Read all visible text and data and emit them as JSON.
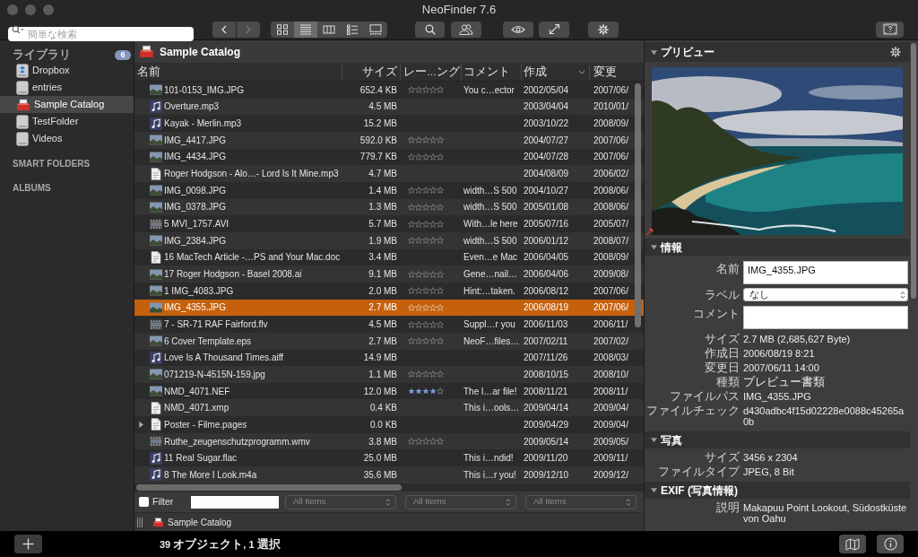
{
  "window": {
    "title": "NeoFinder 7.6"
  },
  "toolbar": {
    "search": {
      "placeholder": "簡単な検索"
    },
    "nav_buttons": [
      {
        "disabled": false
      },
      {
        "disabled": true
      }
    ],
    "view_buttons": [
      {
        "selected": false
      },
      {
        "selected": true
      },
      {
        "selected": false
      },
      {
        "selected": false
      },
      {
        "selected": false
      }
    ]
  },
  "sidebar": {
    "sections": [
      {
        "title": "ライブラリ",
        "badge": "6",
        "items": [
          {
            "kind": "cloud",
            "label": "Dropbox",
            "selected": false
          },
          {
            "kind": "volume",
            "label": "entries",
            "selected": false
          },
          {
            "kind": "catalog",
            "label": "Sample Catalog",
            "selected": true
          },
          {
            "kind": "volume",
            "label": "TestFolder",
            "selected": false
          },
          {
            "kind": "volume",
            "label": "Videos",
            "selected": false
          }
        ]
      },
      {
        "title": "SMART FOLDERS"
      },
      {
        "title": "ALBUMS"
      }
    ]
  },
  "table": {
    "title": "Sample Catalog",
    "columns": [
      {
        "label": "名前",
        "sorted": false
      },
      {
        "label": "サイズ",
        "sorted": false
      },
      {
        "label": "レー…ング",
        "sorted": false
      },
      {
        "label": "コメント",
        "sorted": false
      },
      {
        "label": "作成",
        "sorted": true
      },
      {
        "label": "変更",
        "sorted": false
      }
    ],
    "rows": [
      {
        "kind": "image",
        "name": "101-0153_IMG.JPG",
        "size": "652.4 KB",
        "stars": 0,
        "comment": "You c…ector",
        "created": "2002/05/04",
        "modified": "2007/06/",
        "selected": false
      },
      {
        "kind": "audio",
        "name": "Overture.mp3",
        "size": "4.5 MB",
        "created": "2003/04/04",
        "modified": "2010/01/",
        "selected": false
      },
      {
        "kind": "audio",
        "name": "Kayak - Merlin.mp3",
        "size": "15.2 MB",
        "created": "2003/10/22",
        "modified": "2008/09/",
        "selected": false
      },
      {
        "kind": "image",
        "name": "IMG_4417.JPG",
        "size": "592.0 KB",
        "stars": 0,
        "created": "2004/07/27",
        "modified": "2007/06/",
        "selected": false
      },
      {
        "kind": "image",
        "name": "IMG_4434.JPG",
        "size": "779.7 KB",
        "stars": 0,
        "created": "2004/07/28",
        "modified": "2007/06/",
        "selected": false
      },
      {
        "kind": "document",
        "name": "Roger Hodgson - Alo…- Lord Is It Mine.mp3",
        "size": "4.7 MB",
        "created": "2004/08/09",
        "modified": "2006/02/",
        "selected": false
      },
      {
        "kind": "image",
        "name": "IMG_0098.JPG",
        "size": "1.4 MB",
        "stars": 0,
        "comment": "width…S 500",
        "created": "2004/10/27",
        "modified": "2008/06/",
        "selected": false
      },
      {
        "kind": "image",
        "name": "IMG_0378.JPG",
        "size": "1.3 MB",
        "stars": 0,
        "comment": "width…S 500",
        "created": "2005/01/08",
        "modified": "2008/06/",
        "selected": false
      },
      {
        "kind": "video",
        "name": "5 MVI_1757.AVI",
        "size": "5.7 MB",
        "stars": 0,
        "comment": "With…le here",
        "created": "2005/07/16",
        "modified": "2005/07/",
        "selected": false
      },
      {
        "kind": "image",
        "name": "IMG_2384.JPG",
        "size": "1.9 MB",
        "stars": 0,
        "comment": "width…S 500",
        "created": "2006/01/12",
        "modified": "2008/07/",
        "selected": false
      },
      {
        "kind": "document",
        "name": "16 MacTech Article -…PS and Your Mac.doc",
        "size": "3.4 MB",
        "comment": "Even…e Mac",
        "created": "2006/04/05",
        "modified": "2008/09/",
        "selected": false
      },
      {
        "kind": "image",
        "name": "17 Roger Hodgson - Basel 2008.ai",
        "size": "9.1 MB",
        "stars": 0,
        "comment": "Gene…nail…",
        "created": "2006/04/06",
        "modified": "2009/08/",
        "selected": false
      },
      {
        "kind": "image",
        "name": "1 IMG_4083.JPG",
        "size": "2.0 MB",
        "stars": 0,
        "comment": "Hint:…taken.",
        "created": "2006/08/12",
        "modified": "2007/06/",
        "selected": false
      },
      {
        "kind": "image",
        "name": "IMG_4355.JPG",
        "size": "2.7 MB",
        "stars": 0,
        "created": "2006/08/19",
        "modified": "2007/06/",
        "selected": true
      },
      {
        "kind": "video",
        "name": "7 - SR-71 RAF Fairford.flv",
        "size": "4.5 MB",
        "stars": 0,
        "comment": "Suppl…r you",
        "created": "2006/11/03",
        "modified": "2006/11/",
        "selected": false
      },
      {
        "kind": "image",
        "name": "6 Cover Template.eps",
        "size": "2.7 MB",
        "stars": 0,
        "comment": "NeoF…files…",
        "created": "2007/02/11",
        "modified": "2007/02/",
        "selected": false
      },
      {
        "kind": "audio",
        "name": "Love Is A Thousand Times.aiff",
        "size": "14.9 MB",
        "created": "2007/11/26",
        "modified": "2008/03/",
        "selected": false
      },
      {
        "kind": "image",
        "name": "071219-N-4515N-159.jpg",
        "size": "1.1 MB",
        "stars": 0,
        "created": "2008/10/15",
        "modified": "2008/10/",
        "selected": false
      },
      {
        "kind": "image",
        "name": "NMD_4071.NEF",
        "size": "12.0 MB",
        "stars": 4,
        "comment": "The l…ar file!",
        "created": "2008/11/21",
        "modified": "2008/11/",
        "selected": false
      },
      {
        "kind": "document",
        "name": "NMD_4071.xmp",
        "size": "0.4 KB",
        "comment": "This i…ools…",
        "created": "2009/04/14",
        "modified": "2009/04/",
        "selected": false
      },
      {
        "kind": "document",
        "name": "Poster - Filme.pages",
        "expanded": false,
        "size": "0.0 KB",
        "created": "2009/04/29",
        "modified": "2009/04/",
        "selected": false
      },
      {
        "kind": "video",
        "name": "Ruthe_zeugenschutzprogramm.wmv",
        "size": "3.8 MB",
        "stars": 0,
        "created": "2009/05/14",
        "modified": "2009/05/",
        "selected": false
      },
      {
        "kind": "audio",
        "name": "11 Real Sugar.flac",
        "size": "25.0 MB",
        "comment": "This i…ndid!",
        "created": "2009/11/20",
        "modified": "2009/11/",
        "selected": false
      },
      {
        "kind": "audio",
        "name": "8 The More I Look.m4a",
        "size": "35.6 MB",
        "comment": "This i…r you!",
        "created": "2009/12/10",
        "modified": "2009/12/",
        "selected": false
      }
    ]
  },
  "filter": {
    "label": "Filter",
    "checked": false,
    "popups": [
      {
        "value": "All Items",
        "disabled": true
      },
      {
        "value": "All Items",
        "disabled": true
      },
      {
        "value": "All Items",
        "disabled": true
      }
    ]
  },
  "path_bar": {
    "catalog": "Sample Catalog"
  },
  "inspector": {
    "sections": [
      {
        "kind": "preview",
        "title": "プリビュー",
        "expanded": true
      },
      {
        "kind": "details",
        "title": "情報",
        "expanded": true,
        "fields": [
          {
            "kind": "text",
            "label": "名前",
            "value": "IMG_4355.JPG"
          },
          {
            "kind": "popup",
            "label": "ラベル",
            "value": "なし"
          },
          {
            "kind": "text",
            "label": "コメント"
          }
        ],
        "properties": [
          {
            "label": "サイズ",
            "value": "2.7 MB (2,685,627 Byte)"
          },
          {
            "label": "作成日",
            "value": "2006/08/19 8:21"
          },
          {
            "label": "変更日",
            "value": "2007/06/11 14:00"
          },
          {
            "label": "種類",
            "value": "プレビュー書類"
          },
          {
            "label": "ファイルパス",
            "value": "IMG_4355.JPG"
          },
          {
            "label": "ファイルチェック",
            "value": "d430adbc4f15d02228e0088c45265a0b"
          }
        ]
      },
      {
        "kind": "details",
        "title": "写真",
        "expanded": true,
        "properties": [
          {
            "label": "サイズ",
            "value": "3456 x 2304"
          },
          {
            "label": "ファイルタイプ",
            "value": "JPEG, 8 Bit"
          }
        ]
      },
      {
        "kind": "details",
        "title": "EXIF (写真情報)",
        "expanded": true,
        "properties": [
          {
            "label": "説明",
            "value": "Makapuu Point Lookout, Südostküste von Oahu"
          }
        ]
      }
    ]
  },
  "status_bar": {
    "text": "39 オブジェクト, 1 選択"
  }
}
